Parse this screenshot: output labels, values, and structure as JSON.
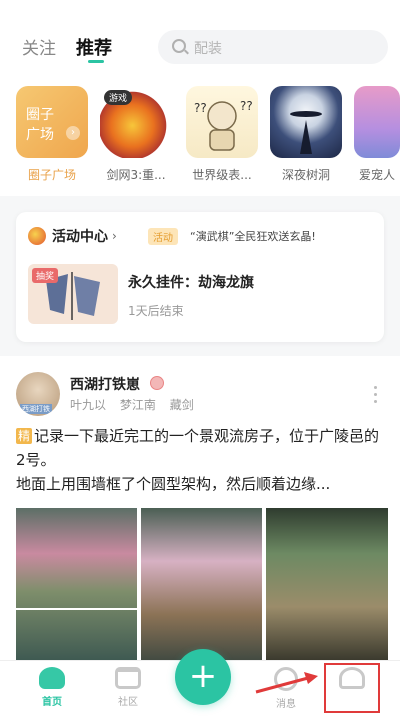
{
  "header": {
    "tabs": [
      {
        "label": "关注",
        "active": false
      },
      {
        "label": "推荐",
        "active": true
      }
    ],
    "search": {
      "placeholder": "配装",
      "icon": "search-icon"
    }
  },
  "circles": [
    {
      "label": "圈子广场",
      "thumb_text": [
        "圈子",
        "广场"
      ],
      "highlight": true
    },
    {
      "label": "剑网3:重...",
      "tag": "游戏"
    },
    {
      "label": "世界级表..."
    },
    {
      "label": "深夜树洞"
    },
    {
      "label": "爱宠人"
    }
  ],
  "activity": {
    "title": "活动中心",
    "tag": "活动",
    "message": "“演武棋”全民狂欢送玄晶!",
    "item": {
      "badge": "抽奖",
      "name": "永久挂件：劫海龙旗",
      "status": "1天后结束"
    }
  },
  "post": {
    "author": "西湖打铁崽",
    "meta": [
      "叶九以",
      "梦江南",
      "藏剑"
    ],
    "badge": "精",
    "text_line1": "记录一下最近完工的一个景观流房子，位于广陵邑的2号。",
    "text_line2": "地面上用围墙框了个圆型架构，然后顺着边缘...",
    "avatar_stamp": "西湖打铁"
  },
  "nav": {
    "home": "首页",
    "community": "社区",
    "add": "+",
    "messages": "消息",
    "me": ""
  },
  "colors": {
    "accent": "#2bc4a3",
    "highlight_box": "#e03a3a",
    "plaza": "#efa64d"
  }
}
